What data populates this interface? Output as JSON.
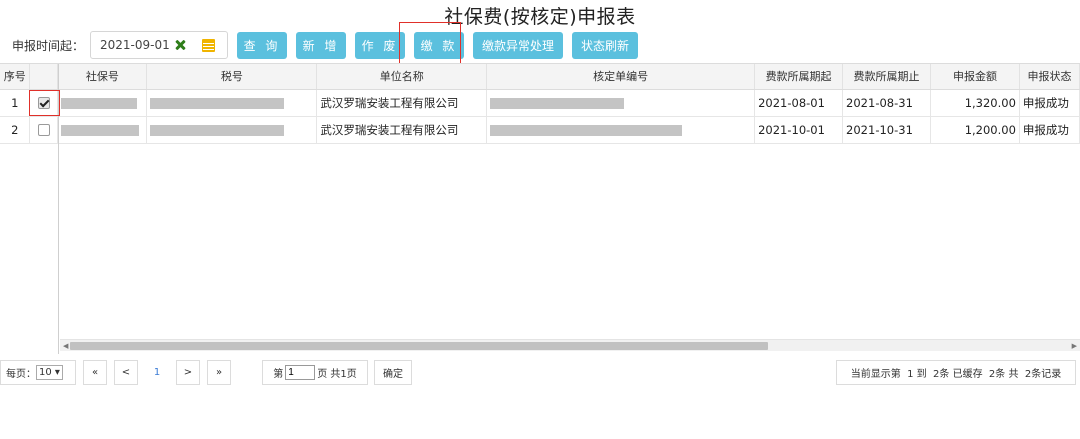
{
  "page_title": "社保费(按核定)申报表",
  "filter": {
    "date_label": "申报时间起：",
    "date_value": "2021-09-01"
  },
  "toolbar": {
    "query": "查 询",
    "add": "新 增",
    "void": "作 废",
    "pay": "缴 款",
    "pay_exception": "缴款异常处理",
    "refresh_status": "状态刷新"
  },
  "table": {
    "headers": [
      "序号",
      "",
      "社保号",
      "税号",
      "单位名称",
      "核定单编号",
      "费款所属期起",
      "费款所属期止",
      "申报金额",
      "申报状态"
    ],
    "rows": [
      {
        "index": "1",
        "checked": true,
        "company": "武汉罗瑞安装工程有限公司",
        "period_start": "2021-08-01",
        "period_end": "2021-08-31",
        "amount": "1,320.00",
        "status": "申报成功"
      },
      {
        "index": "2",
        "checked": false,
        "company": "武汉罗瑞安装工程有限公司",
        "period_start": "2021-10-01",
        "period_end": "2021-10-31",
        "amount": "1,200.00",
        "status": "申报成功"
      }
    ]
  },
  "pager": {
    "per_page_label": "每页：",
    "per_page_value": "10",
    "first": "«",
    "prev": "<",
    "current": "1",
    "next": ">",
    "last": "»",
    "page_prefix": "第",
    "page_input": "1",
    "page_suffix": "页 共1页",
    "confirm": "确定",
    "summary": "当前显示第  1 到  2条 已缓存  2条 共  2条记录"
  }
}
